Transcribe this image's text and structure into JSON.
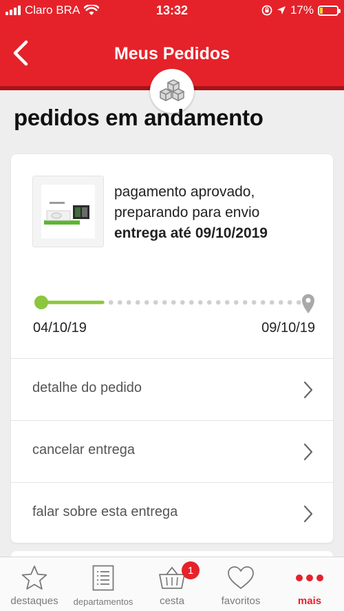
{
  "status_bar": {
    "carrier": "Claro BRA",
    "time": "13:32",
    "battery": "17%",
    "battery_level": 0.17
  },
  "header": {
    "title": "Meus Pedidos",
    "back_icon": "chevron-left-icon",
    "badge_icon": "boxes-icon"
  },
  "section": {
    "title": "pedidos em andamento"
  },
  "order": {
    "status_line_1": "pagamento aprovado,",
    "status_line_2": "preparando para envio",
    "deadline": "entrega até 09/10/2019",
    "tracker": {
      "start_date": "04/10/19",
      "end_date": "09/10/19",
      "progress": 0.23
    },
    "options": [
      {
        "label": "detalhe do pedido"
      },
      {
        "label": "cancelar entrega"
      },
      {
        "label": "falar sobre esta entrega"
      }
    ]
  },
  "bottom_nav": {
    "items": [
      {
        "label": "destaques",
        "icon": "star-icon"
      },
      {
        "label": "departamentos",
        "icon": "list-icon"
      },
      {
        "label": "cesta",
        "icon": "basket-icon",
        "badge": "1"
      },
      {
        "label": "favoritos",
        "icon": "heart-icon"
      },
      {
        "label": "mais",
        "icon": "more-dots-icon",
        "active": true
      }
    ]
  },
  "colors": {
    "brand_red": "#e5222a",
    "progress_green": "#8cc63f",
    "gray_text": "#555555"
  }
}
